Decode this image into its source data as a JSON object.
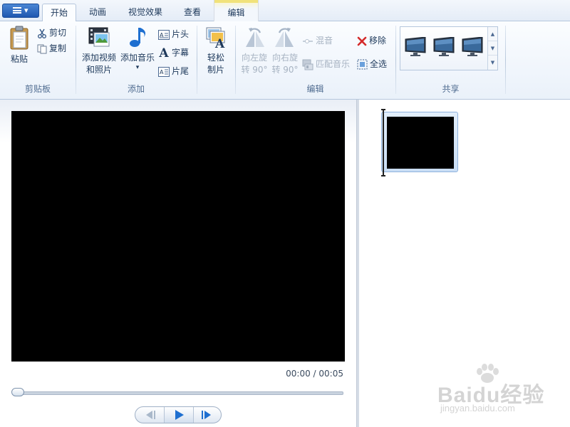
{
  "tabs": {
    "app_menu_arrow": "▾",
    "home": "开始",
    "animations": "动画",
    "visual_effects": "视觉效果",
    "view": "查看",
    "edit": "编辑"
  },
  "ribbon": {
    "clipboard": {
      "group_label": "剪贴板",
      "paste": "粘贴",
      "cut": "剪切",
      "copy": "复制"
    },
    "add": {
      "group_label": "添加",
      "add_videos_line1": "添加视频",
      "add_videos_line2": "和照片",
      "add_music": "添加音乐",
      "add_music_arrow": "▾",
      "title": "片头",
      "caption": "字幕",
      "credits": "片尾"
    },
    "automovie": {
      "label_line1": "轻松",
      "label_line2": "制片"
    },
    "editing": {
      "group_label": "编辑",
      "rotate_left_line1": "向左旋",
      "rotate_left_line2": "转 90°",
      "rotate_right_line1": "向右旋",
      "rotate_right_line2": "转 90°",
      "mix": "混音",
      "fit_music": "匹配音乐",
      "remove": "移除",
      "select_all": "全选"
    },
    "share": {
      "group_label": "共享"
    }
  },
  "player": {
    "time": "00:00 / 00:05",
    "progress": 0
  },
  "watermark": {
    "logo": "Baidu经验",
    "url": "jingyan.baidu.com"
  },
  "colors": {
    "accent": "#1f57b0",
    "remove_red": "#d42b2b",
    "icon_blue": "#1e6fd0"
  }
}
